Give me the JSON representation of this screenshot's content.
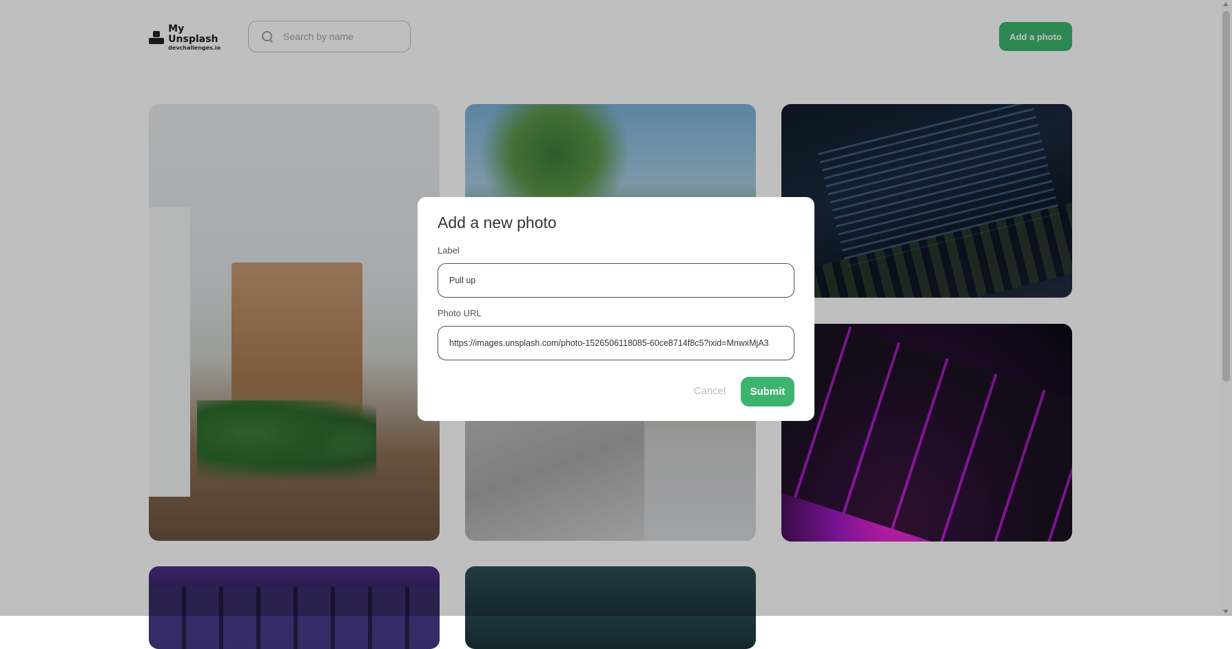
{
  "header": {
    "app_title": "My Unsplash",
    "app_subtitle": "devchallenges.io",
    "search_placeholder": "Search by name",
    "add_button_label": "Add a photo"
  },
  "modal": {
    "title": "Add a new photo",
    "label_field_label": "Label",
    "label_value": "Pull up",
    "url_field_label": "Photo URL",
    "url_value": "https://images.unsplash.com/photo-1526506118085-60ce8714f8c5?ixid=MnwxMjA3",
    "cancel_label": "Cancel",
    "submit_label": "Submit"
  },
  "colors": {
    "accent": "#3db46d",
    "overlay": "rgba(0,0,0,0.25)"
  }
}
